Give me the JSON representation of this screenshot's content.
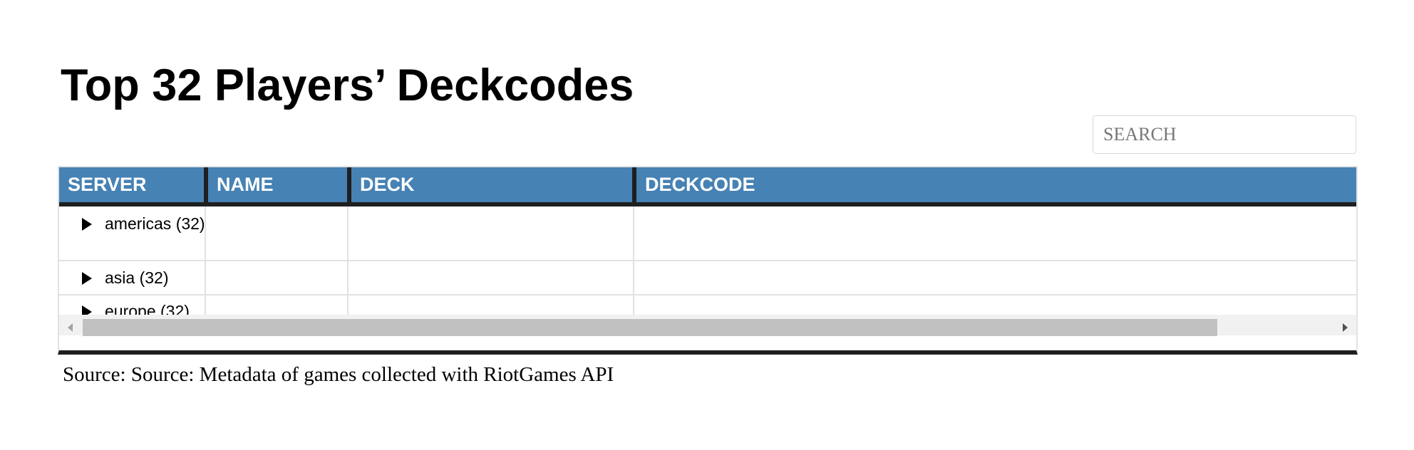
{
  "page": {
    "title": "Top 32 Players’ Deckcodes",
    "source": "Source: Source: Metadata of games collected with RiotGames API"
  },
  "search": {
    "placeholder": "SEARCH",
    "value": ""
  },
  "table": {
    "header_color": "#4682b4",
    "columns": [
      {
        "key": "server",
        "label": "SERVER"
      },
      {
        "key": "name",
        "label": "NAME"
      },
      {
        "key": "deck",
        "label": "DECK"
      },
      {
        "key": "deckcode",
        "label": "DECKCODE"
      }
    ],
    "groups": [
      {
        "label": "americas (32)",
        "expanded": false
      },
      {
        "label": "asia (32)",
        "expanded": false
      },
      {
        "label": "europe (32)",
        "expanded": false
      }
    ]
  }
}
